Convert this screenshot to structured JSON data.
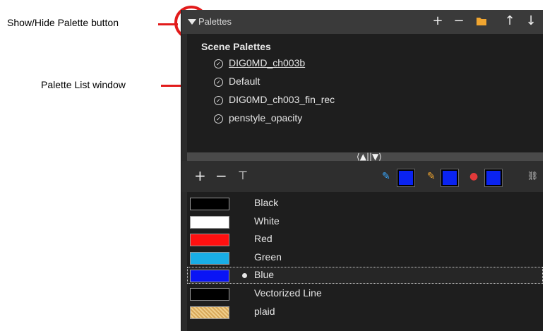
{
  "annotations": {
    "show_hide_label": "Show/Hide Palette button",
    "palette_list_label": "Palette List window"
  },
  "header": {
    "title": "Palettes",
    "buttons": [
      "+",
      "−",
      "folder-icon",
      "↑",
      "↓"
    ]
  },
  "palette_list": {
    "group_title": "Scene Palettes",
    "items": [
      {
        "label": "DIG0MD_ch003b",
        "underlined": true
      },
      {
        "label": "Default"
      },
      {
        "label": "DIG0MD_ch003_fin_rec"
      },
      {
        "label": "penstyle_opacity"
      }
    ]
  },
  "splitter": {
    "label": "⟨▲||▼⟩"
  },
  "color_toolbar": {
    "add": "+",
    "remove": "−",
    "swatch_colors": [
      "#0a23f0",
      "#0a23f0",
      "#0a23f0"
    ]
  },
  "colors": [
    {
      "name": "Black",
      "hex": "#000000",
      "selected": false
    },
    {
      "name": "White",
      "hex": "#ffffff",
      "selected": false
    },
    {
      "name": "Red",
      "hex": "#ff1010",
      "selected": false
    },
    {
      "name": "Green",
      "hex": "#19aee6",
      "selected": false
    },
    {
      "name": "Blue",
      "hex": "#0a14f5",
      "selected": true
    },
    {
      "name": "Vectorized Line",
      "hex": "#000000",
      "selected": false
    },
    {
      "name": "plaid",
      "hex": "#e3b96c",
      "selected": false,
      "texture": true
    }
  ]
}
